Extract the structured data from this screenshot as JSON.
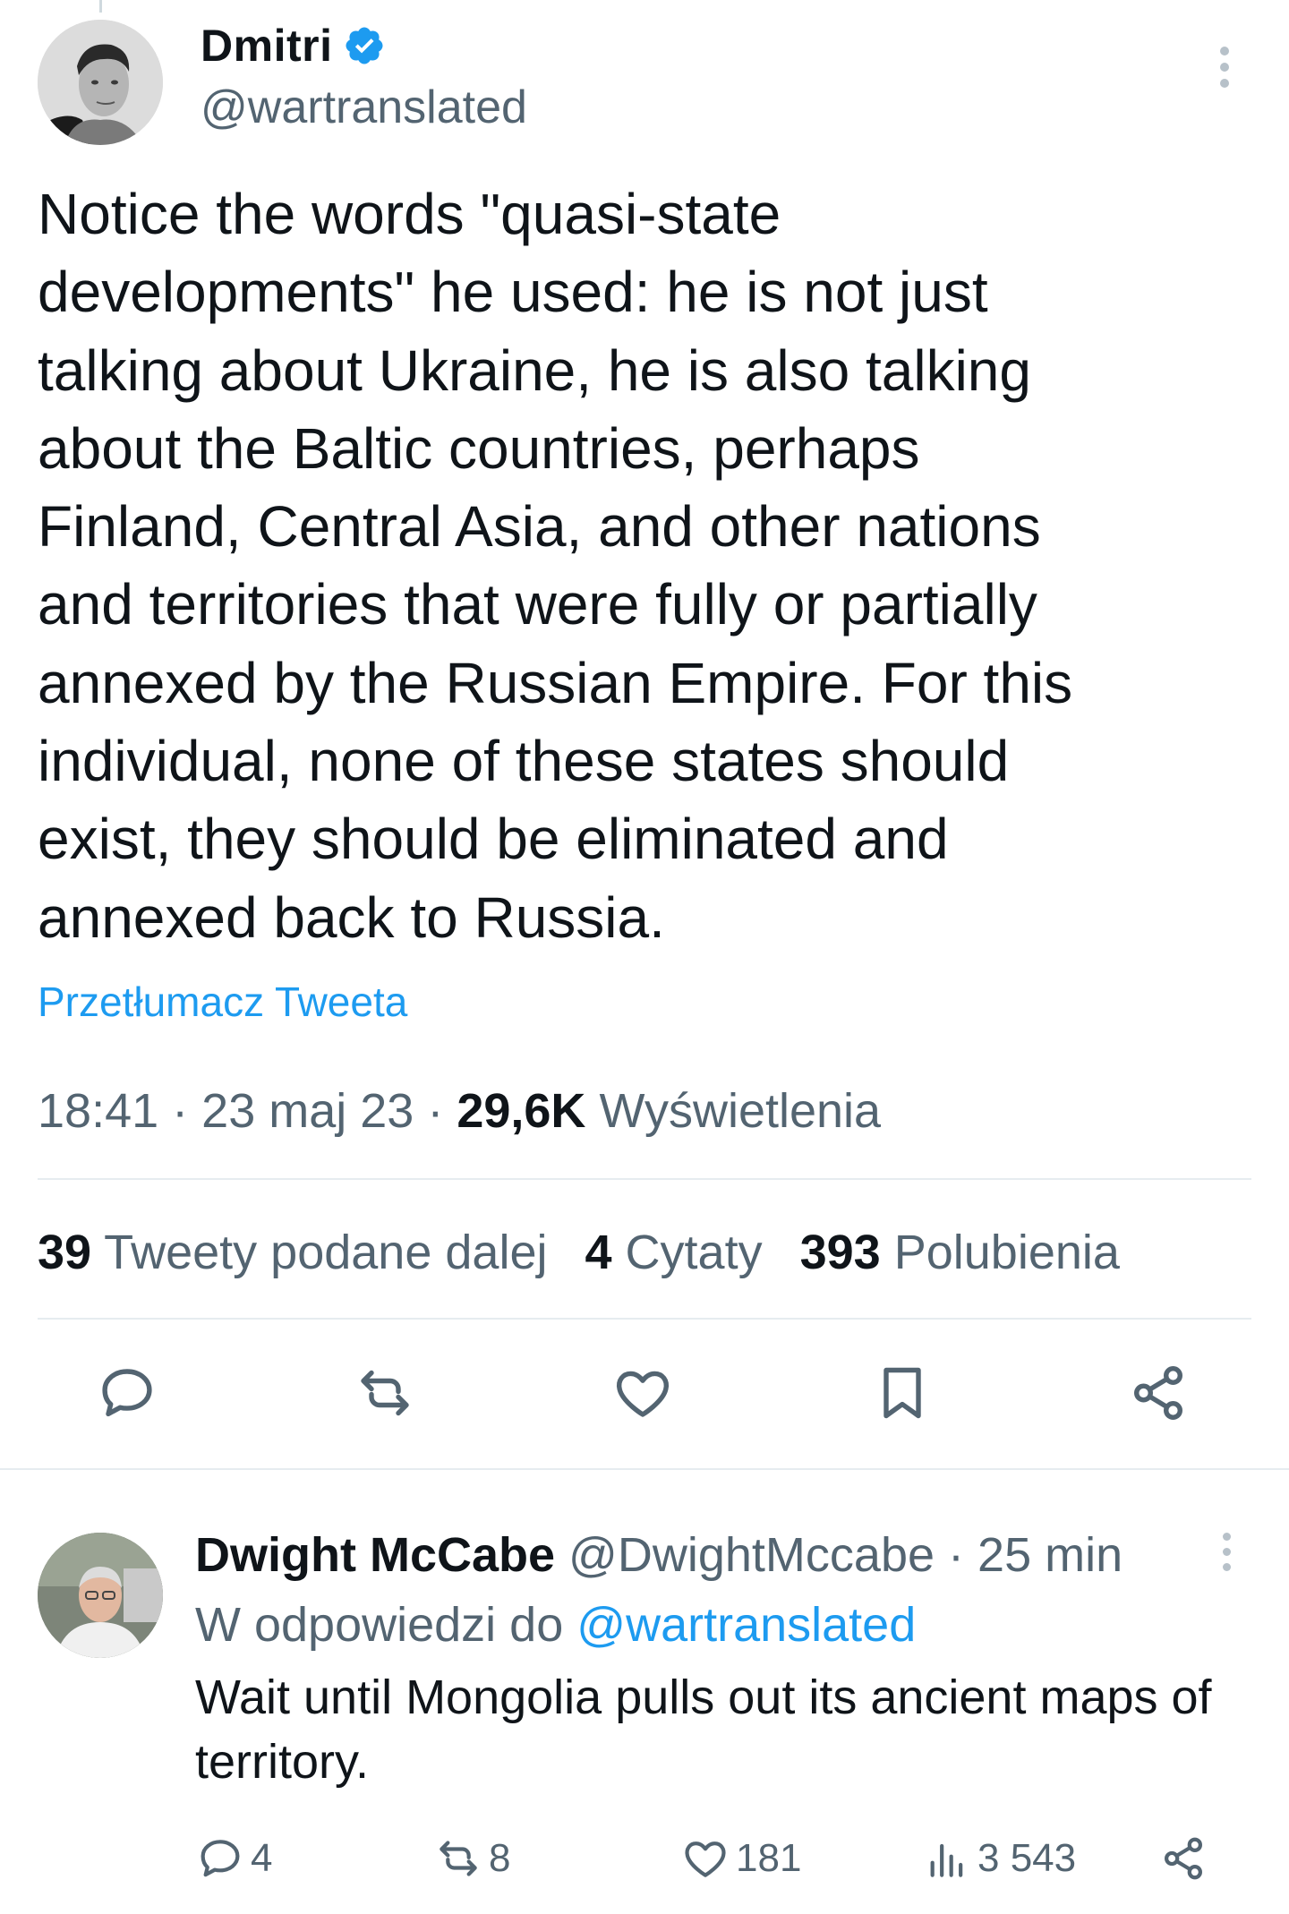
{
  "main_tweet": {
    "author_name": "Dmitri",
    "author_handle": "@wartranslated",
    "text": "Notice the words \"quasi-state\ndevelopments\" he used: he is not just\ntalking about Ukraine, he is also talking\nabout the Baltic countries, perhaps\nFinland, Central Asia, and other nations\nand territories that were fully or partially\nannexed by the Russian Empire. For this\nindividual, none of these states should\nexist, they should be eliminated and\nannexed back to Russia.",
    "translate_label": "Przetłumacz Tweeta",
    "time": "18:41",
    "date": "23 maj 23",
    "separator": "·",
    "views_count": "29,6K",
    "views_label": "Wyświetlenia",
    "retweets_count": "39",
    "retweets_label": "Tweety podane dalej",
    "quotes_count": "4",
    "quotes_label": "Cytaty",
    "likes_count": "393",
    "likes_label": "Polubienia",
    "actions": [
      "reply-icon",
      "retweet-icon",
      "like-icon",
      "bookmark-icon",
      "share-icon"
    ]
  },
  "reply": {
    "author_name": "Dwight McCabe",
    "author_handle": "@DwightMccabe",
    "time_ago": "25 min",
    "separator": "·",
    "replying_prefix": "W odpowiedzi do",
    "replying_to": "@wartranslated",
    "text": "Wait until Mongolia pulls out its ancient maps of territory.",
    "reply_count": "4",
    "retweet_count": "8",
    "like_count": "181",
    "views_count": "3 543"
  },
  "colors": {
    "accent": "#1d9bf0",
    "text_primary": "#0f1419",
    "text_secondary": "#536471",
    "divider": "#e6ecf0"
  }
}
